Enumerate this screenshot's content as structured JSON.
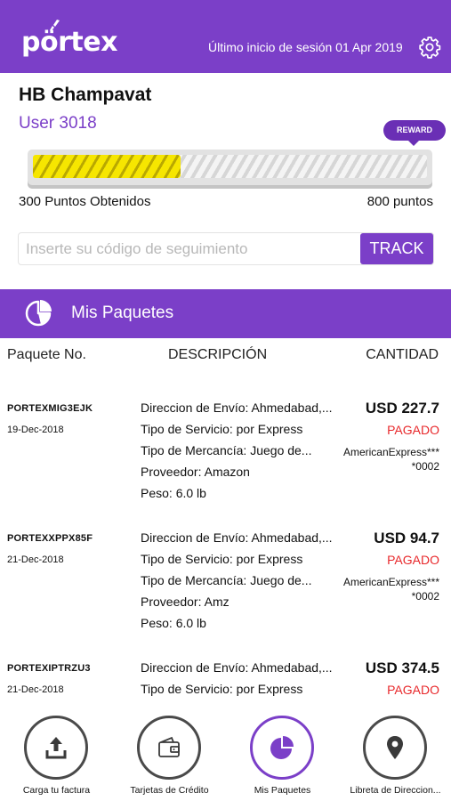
{
  "header": {
    "logo": "pörtex",
    "last_login": "Último inicio de sesión 01 Apr 2019"
  },
  "user": {
    "name": "HB Champavat",
    "id": "User 3018"
  },
  "reward": {
    "label": "REWARD",
    "points_earned_label": "300 Puntos Obtenidos",
    "points_goal_label": "800 puntos",
    "progress_fraction": 0.375
  },
  "tracking": {
    "placeholder": "Inserte su código de seguimiento",
    "button_label": "TRACK"
  },
  "packages_section": {
    "title": "Mis Paquetes",
    "columns": [
      "Paquete No.",
      "DESCRIPCIÓN",
      "CANTIDAD"
    ]
  },
  "packages": [
    {
      "number": "PORTEXMIG3EJK",
      "date": "19-Dec-2018",
      "description": [
        "Direccion de Envío: Ahmedabad,...",
        "Tipo de Servicio: por Express",
        "Tipo de Mercancía: Juego de...",
        "Proveedor: Amazon",
        "Peso: 6.0 lb"
      ],
      "amount": "USD 227.7",
      "status": "PAGADO",
      "card": "AmericanExpress****0002"
    },
    {
      "number": "PORTEXXPPX85F",
      "date": "21-Dec-2018",
      "description": [
        "Direccion de Envío: Ahmedabad,...",
        "Tipo de Servicio: por Express",
        "Tipo de Mercancía: Juego de...",
        "Proveedor: Amz",
        "Peso: 6.0 lb"
      ],
      "amount": "USD 94.7",
      "status": "PAGADO",
      "card": "AmericanExpress****0002"
    },
    {
      "number": "PORTEXIPTRZU3",
      "date": "21-Dec-2018",
      "description": [
        "Direccion de Envío: Ahmedabad,...",
        "Tipo de Servicio: por Express"
      ],
      "amount": "USD 374.5",
      "status": "PAGADO",
      "card": ""
    }
  ],
  "bottom_nav": [
    {
      "label": "Carga tu factura",
      "icon": "upload-icon",
      "active": false
    },
    {
      "label": "Tarjetas de Crédito",
      "icon": "wallet-icon",
      "active": false
    },
    {
      "label": "Mis Paquetes",
      "icon": "pie-chart-icon",
      "active": true
    },
    {
      "label": "Libreta de Direccion...",
      "icon": "location-pin-icon",
      "active": false
    }
  ],
  "colors": {
    "brand_purple": "#7b3fc8",
    "status_red": "#e8282b",
    "progress_yellow": "#f6e600"
  }
}
